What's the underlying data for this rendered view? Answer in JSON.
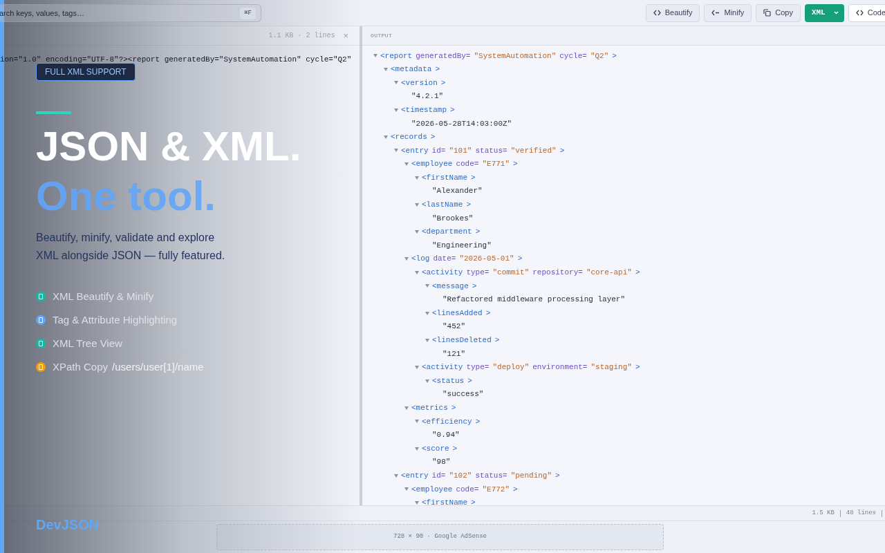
{
  "toolbar": {
    "search": {
      "placeholder": "arch keys, values, tags…",
      "shortcut": "⌘F"
    },
    "buttons": [
      {
        "label": "Beautify",
        "kind": "code"
      },
      {
        "label": "Minify",
        "kind": "arrow"
      },
      {
        "label": "Copy",
        "kind": "copy"
      },
      {
        "label": "XML",
        "kind": "split"
      },
      {
        "label": "Code",
        "kind": "code-outline"
      }
    ]
  },
  "input": {
    "info": "1.1 KB · 2 lines",
    "close": "×",
    "line": "ion=\"1.0\" encoding=\"UTF-8\"?><report generatedBy=\"SystemAutomation\" cycle=\"Q2\""
  },
  "output": {
    "title": "OUTPUT",
    "tree": [
      {
        "kind": "element",
        "open": "<report",
        "attrs": [
          {
            "name": "generatedBy=",
            "value": "\"SystemAutomation\""
          },
          {
            "name": "cycle=",
            "value": "\"Q2\""
          }
        ],
        "close": ">",
        "expanded": true,
        "children": [
          {
            "kind": "element",
            "open": "<metadata",
            "close": ">",
            "expanded": true,
            "children": [
              {
                "kind": "element",
                "open": "<version",
                "close": ">",
                "expanded": true,
                "children": [
                  {
                    "kind": "text",
                    "value": "\"4.2.1\""
                  }
                ]
              },
              {
                "kind": "element",
                "open": "<timestamp",
                "close": ">",
                "expanded": true,
                "children": [
                  {
                    "kind": "text",
                    "value": "\"2026-05-28T14:03:00Z\""
                  }
                ]
              }
            ]
          },
          {
            "kind": "element",
            "open": "<records",
            "close": ">",
            "expanded": true,
            "children": [
              {
                "kind": "element",
                "open": "<entry",
                "attrs": [
                  {
                    "name": "id=",
                    "value": "\"101\""
                  },
                  {
                    "name": "status=",
                    "value": "\"verified\""
                  }
                ],
                "close": ">",
                "expanded": true,
                "children": [
                  {
                    "kind": "element",
                    "open": "<employee",
                    "attrs": [
                      {
                        "name": "code=",
                        "value": "\"E771\""
                      }
                    ],
                    "close": ">",
                    "expanded": true,
                    "children": [
                      {
                        "kind": "element",
                        "open": "<firstName",
                        "close": ">",
                        "expanded": true,
                        "children": [
                          {
                            "kind": "text",
                            "value": "\"Alexander\""
                          }
                        ]
                      },
                      {
                        "kind": "element",
                        "open": "<lastName",
                        "close": ">",
                        "expanded": true,
                        "children": [
                          {
                            "kind": "text",
                            "value": "\"Brookes\""
                          }
                        ]
                      },
                      {
                        "kind": "element",
                        "open": "<department",
                        "close": ">",
                        "expanded": true,
                        "children": [
                          {
                            "kind": "text",
                            "value": "\"Engineering\""
                          }
                        ]
                      }
                    ]
                  },
                  {
                    "kind": "element",
                    "open": "<log",
                    "attrs": [
                      {
                        "name": "date=",
                        "value": "\"2026-05-01\""
                      }
                    ],
                    "close": ">",
                    "expanded": true,
                    "children": [
                      {
                        "kind": "element",
                        "open": "<activity",
                        "attrs": [
                          {
                            "name": "type=",
                            "value": "\"commit\""
                          },
                          {
                            "name": "repository=",
                            "value": "\"core-api\""
                          }
                        ],
                        "close": ">",
                        "expanded": true,
                        "children": [
                          {
                            "kind": "element",
                            "open": "<message",
                            "close": ">",
                            "expanded": true,
                            "children": [
                              {
                                "kind": "text",
                                "value": "\"Refactored middleware processing layer\""
                              }
                            ]
                          },
                          {
                            "kind": "element",
                            "open": "<linesAdded",
                            "close": ">",
                            "expanded": true,
                            "children": [
                              {
                                "kind": "text",
                                "value": "\"452\""
                              }
                            ]
                          },
                          {
                            "kind": "element",
                            "open": "<linesDeleted",
                            "close": ">",
                            "expanded": true,
                            "children": [
                              {
                                "kind": "text",
                                "value": "\"121\""
                              }
                            ]
                          }
                        ]
                      },
                      {
                        "kind": "element",
                        "open": "<activity",
                        "attrs": [
                          {
                            "name": "type=",
                            "value": "\"deploy\""
                          },
                          {
                            "name": "environment=",
                            "value": "\"staging\""
                          }
                        ],
                        "close": ">",
                        "expanded": true,
                        "children": [
                          {
                            "kind": "element",
                            "open": "<status",
                            "close": ">",
                            "expanded": true,
                            "children": [
                              {
                                "kind": "text",
                                "value": "\"success\""
                              }
                            ]
                          }
                        ]
                      }
                    ]
                  },
                  {
                    "kind": "element",
                    "open": "<metrics",
                    "close": ">",
                    "expanded": true,
                    "children": [
                      {
                        "kind": "element",
                        "open": "<efficiency",
                        "close": ">",
                        "expanded": true,
                        "children": [
                          {
                            "kind": "text",
                            "value": "\"0.94\""
                          }
                        ]
                      },
                      {
                        "kind": "element",
                        "open": "<score",
                        "close": ">",
                        "expanded": true,
                        "children": [
                          {
                            "kind": "text",
                            "value": "\"98\""
                          }
                        ]
                      }
                    ]
                  }
                ]
              },
              {
                "kind": "element",
                "open": "<entry",
                "attrs": [
                  {
                    "name": "id=",
                    "value": "\"102\""
                  },
                  {
                    "name": "status=",
                    "value": "\"pending\""
                  }
                ],
                "close": ">",
                "expanded": true,
                "children": [
                  {
                    "kind": "element",
                    "open": "<employee",
                    "attrs": [
                      {
                        "name": "code=",
                        "value": "\"E772\""
                      }
                    ],
                    "close": ">",
                    "expanded": true,
                    "children": [
                      {
                        "kind": "element",
                        "open": "<firstName",
                        "close": ">",
                        "expanded": true
                      }
                    ]
                  }
                ]
              }
            ]
          }
        ]
      }
    ]
  },
  "status_bar": {
    "size": "1.5 KB",
    "lines": "48 lines"
  },
  "ad": {
    "label": "728 × 90 · Google AdSense"
  },
  "hero": {
    "badge": "FULL XML SUPPORT",
    "title": "JSON & XML.",
    "subtitle": "One tool.",
    "description": "Beautify, minify, validate and explore XML alongside JSON — fully featured.",
    "features": [
      {
        "label": "XML Beautify & Minify",
        "color": "#14b8a6"
      },
      {
        "label": "Tag & Attribute Highlighting",
        "color": "#60a5fa"
      },
      {
        "label": "XML Tree View",
        "color": "#14b8a6"
      },
      {
        "label": "XPath Copy",
        "extra": "/users/user[1]/name",
        "color": "#f59e0b"
      }
    ],
    "brand": "DevJSON"
  }
}
